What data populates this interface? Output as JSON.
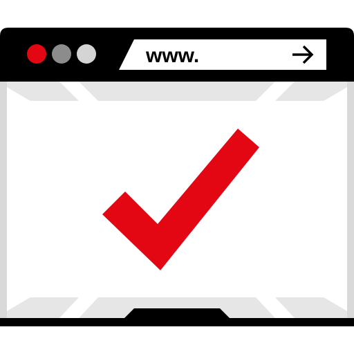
{
  "address_bar": {
    "text": "www.",
    "go_icon": "arrow-right-icon"
  },
  "window_controls": [
    {
      "name": "close-dot",
      "color": "#e30613"
    },
    {
      "name": "minimize-dot",
      "color": "#8c8c8c"
    },
    {
      "name": "maximize-dot",
      "color": "#d4d4d4"
    }
  ],
  "status_icon": "checkmark-icon",
  "colors": {
    "frame": "#000000",
    "accent": "#e30613",
    "content_bg": "#ffffff",
    "content_shade": "#d9d9d9",
    "content_shade_light": "#e6e6e6"
  }
}
